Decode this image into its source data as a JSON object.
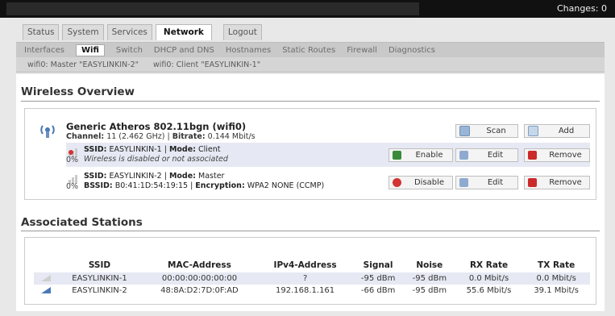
{
  "topbar": {
    "changes": "Changes: 0"
  },
  "main_tabs": [
    {
      "label": "Status",
      "active": false
    },
    {
      "label": "System",
      "active": false
    },
    {
      "label": "Services",
      "active": false
    },
    {
      "label": "Network",
      "active": true
    },
    {
      "label": "Logout",
      "active": false
    }
  ],
  "network_tabs": [
    {
      "label": "Interfaces",
      "active": false
    },
    {
      "label": "Wifi",
      "active": true
    },
    {
      "label": "Switch",
      "active": false
    },
    {
      "label": "DHCP and DNS",
      "active": false
    },
    {
      "label": "Hostnames",
      "active": false
    },
    {
      "label": "Static Routes",
      "active": false
    },
    {
      "label": "Firewall",
      "active": false
    },
    {
      "label": "Diagnostics",
      "active": false
    }
  ],
  "wifi_tabs": [
    "wifi0: Master \"EASYLINKIN-2\"",
    "wifi0: Client \"EASYLINKIN-1\""
  ],
  "overview": {
    "title": "Wireless Overview",
    "radio_name": "Generic Atheros 802.11bgn (wifi0)",
    "channel_label": "Channel:",
    "channel_value": "11 (2.462 GHz)",
    "bitrate_label": "Bitrate:",
    "bitrate_value": "0.144 Mbit/s",
    "scan_label": "Scan",
    "add_label": "Add",
    "networks": [
      {
        "percent": "0%",
        "ssid_label": "SSID:",
        "ssid": "EASYLINKIN-1",
        "mode_label": "Mode:",
        "mode": "Client",
        "line2": "Wireless is disabled or not associated",
        "toggle_label": "Enable",
        "edit_label": "Edit",
        "remove_label": "Remove"
      },
      {
        "percent": "0%",
        "ssid_label": "SSID:",
        "ssid": "EASYLINKIN-2",
        "mode_label": "Mode:",
        "mode": "Master",
        "bssid_label": "BSSID:",
        "bssid": "B0:41:1D:54:19:15",
        "enc_label": "Encryption:",
        "enc": "WPA2 NONE (CCMP)",
        "toggle_label": "Disable",
        "edit_label": "Edit",
        "remove_label": "Remove"
      }
    ]
  },
  "stations": {
    "title": "Associated Stations",
    "columns": [
      "SSID",
      "MAC-Address",
      "IPv4-Address",
      "Signal",
      "Noise",
      "RX Rate",
      "TX Rate"
    ],
    "rows": [
      [
        "EASYLINKIN-1",
        "00:00:00:00:00:00",
        "?",
        "-95 dBm",
        "-95 dBm",
        "0.0 Mbit/s",
        "0.0 Mbit/s"
      ],
      [
        "EASYLINKIN-2",
        "48:8A:D2:7D:0F:AD",
        "192.168.1.161",
        "-66 dBm",
        "-95 dBm",
        "55.6 Mbit/s",
        "39.1 Mbit/s"
      ]
    ]
  },
  "colors": {
    "topbar": "#111111",
    "enable_icon": "#3a8a3a",
    "disable_icon": "#d23333",
    "remove_icon": "#cc2a2a",
    "signal_active": "#4a79b8"
  }
}
